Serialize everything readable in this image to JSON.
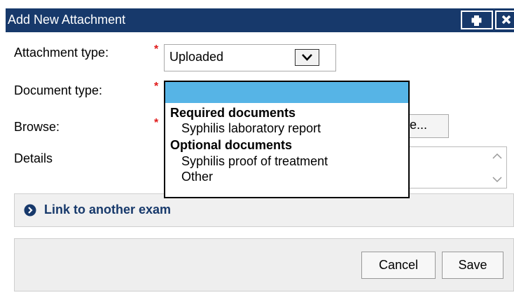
{
  "dialog": {
    "title": "Add New Attachment",
    "add_icon": "plus-icon",
    "close_icon": "close-x-icon"
  },
  "form": {
    "attachment_type_label": "Attachment type:",
    "attachment_type_value": "Uploaded",
    "document_type_label": "Document type:",
    "browse_label": "Browse:",
    "browse_button_fragment": "e...",
    "details_label": "Details",
    "required_marker": "*"
  },
  "document_type_dropdown": {
    "selected_value": "",
    "groups": [
      {
        "label": "Required documents",
        "options": [
          "Syphilis laboratory report"
        ]
      },
      {
        "label": "Optional documents",
        "options": [
          "Syphilis proof of treatment",
          "Other"
        ]
      }
    ]
  },
  "link": {
    "label": "Link to another exam",
    "icon": "circle-chevron-right-icon"
  },
  "footer": {
    "cancel_label": "Cancel",
    "save_label": "Save"
  },
  "colors": {
    "titlebar": "#17396b",
    "selection": "#56b4e6",
    "required": "#e01a1a",
    "link": "#17396b"
  }
}
